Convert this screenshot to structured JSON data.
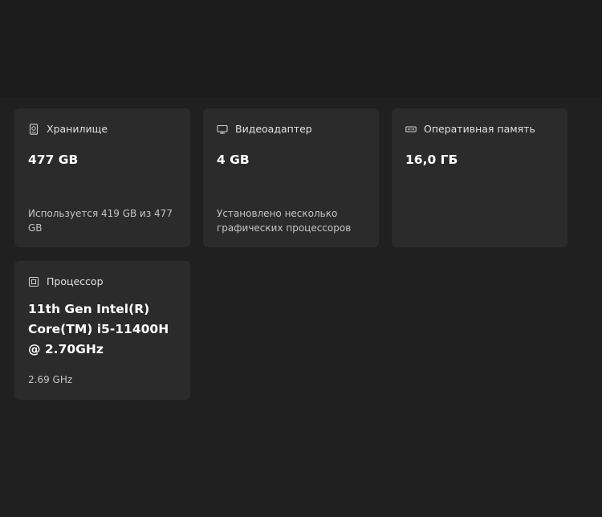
{
  "cards": {
    "storage": {
      "icon": "hard-drive-icon",
      "title": "Хранилище",
      "value": "477 GB",
      "subtitle": "Используется 419 GB из 477 GB"
    },
    "gpu": {
      "icon": "monitor-icon",
      "title": "Видеоадаптер",
      "value": "4 GB",
      "subtitle": "Установлено несколько графических процессоров"
    },
    "ram": {
      "icon": "memory-icon",
      "title": "Оперативная память",
      "value": "16,0 ГБ"
    },
    "cpu": {
      "icon": "cpu-icon",
      "title": "Процессор",
      "value": "11th Gen Intel(R) Core(TM) i5-11400H @ 2.70GHz",
      "subtitle": "2.69 GHz"
    }
  }
}
